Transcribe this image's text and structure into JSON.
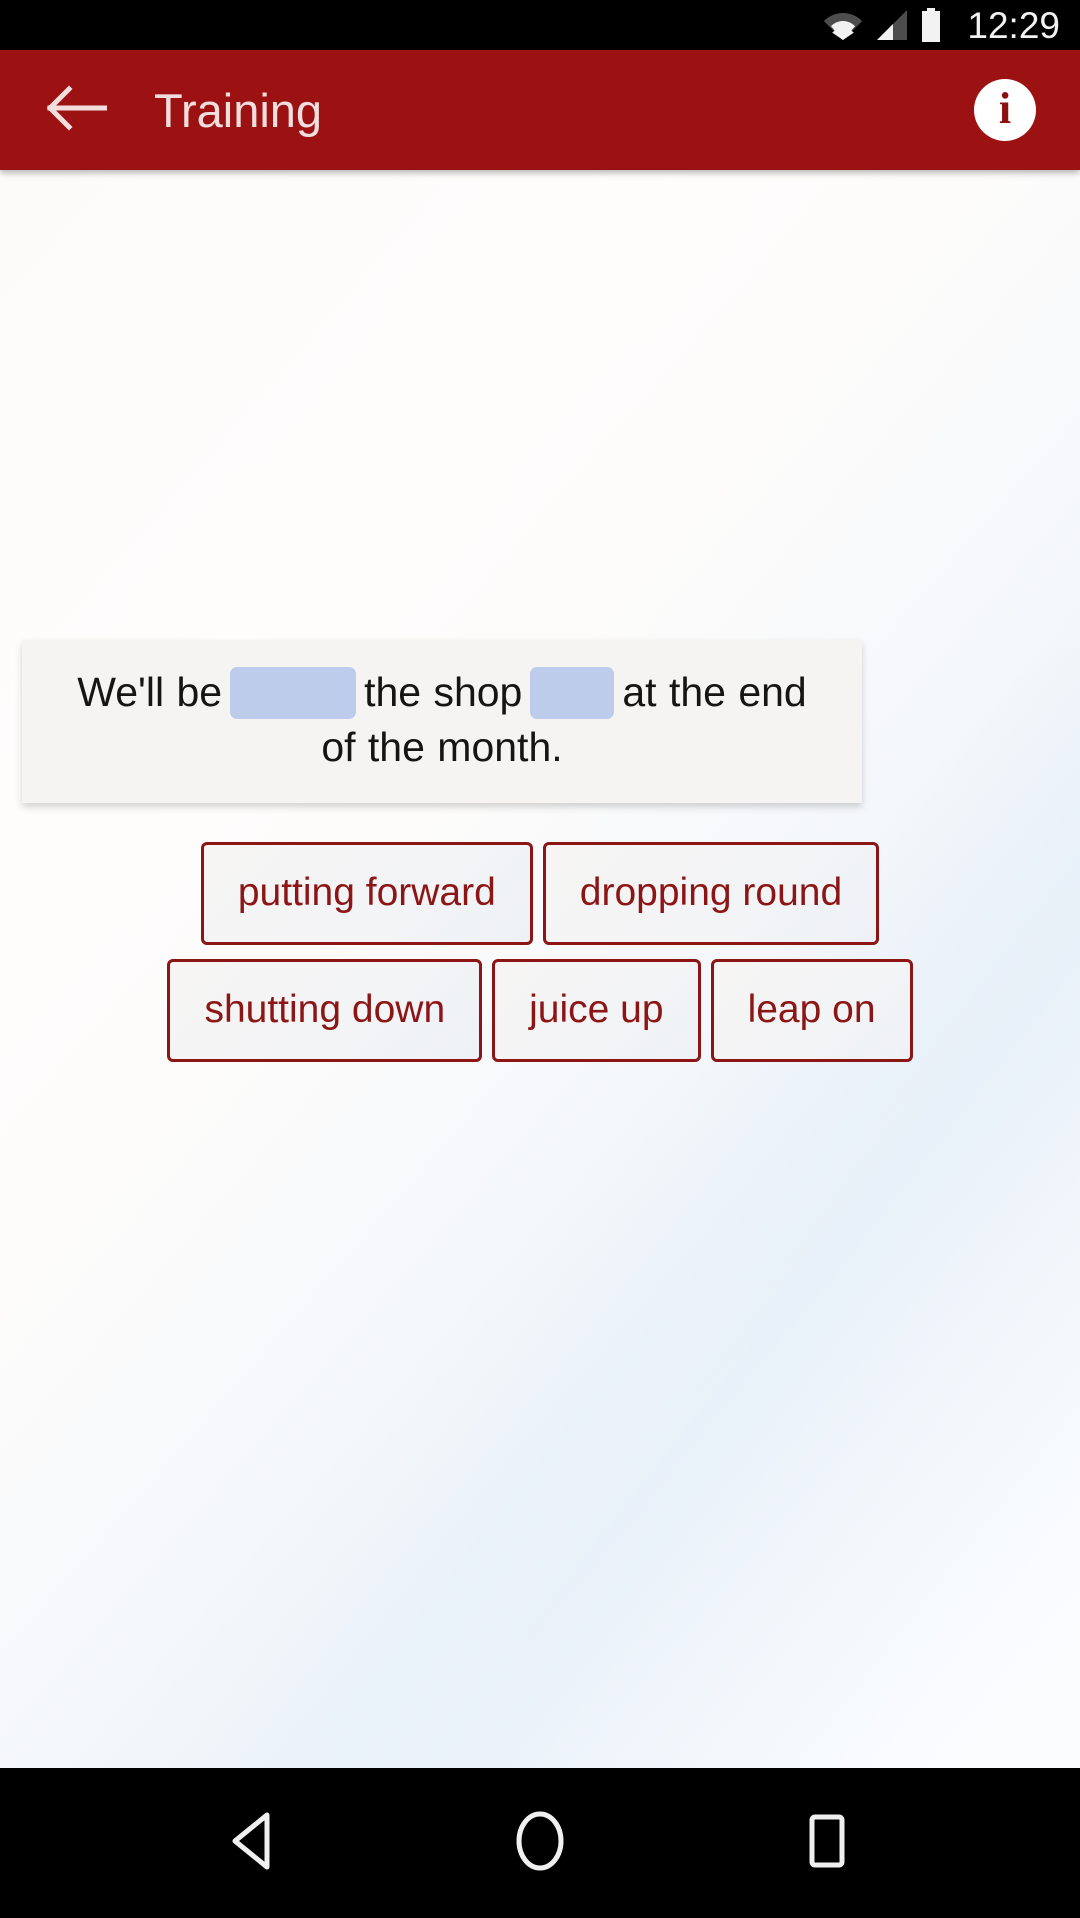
{
  "status_bar": {
    "time": "12:29",
    "icons": [
      "wifi-icon",
      "signal-icon",
      "battery-icon"
    ]
  },
  "app_bar": {
    "back_icon": "back-arrow-icon",
    "title": "Training",
    "info_icon": "info-icon",
    "info_glyph": "i",
    "background_color": "#9c1111",
    "title_color": "#f3dede"
  },
  "exercise": {
    "card_background": "#f5f4f2",
    "blank_color": "#bdccea",
    "sentence_parts": [
      {
        "type": "text",
        "value": "We'll be "
      },
      {
        "type": "blank",
        "value": ""
      },
      {
        "type": "text",
        "value": " the shop "
      },
      {
        "type": "blank",
        "value": ""
      },
      {
        "type": "text",
        "value": " at the end of the month."
      }
    ],
    "sentence_full": "We'll be ___ the shop ___ at the end of the month.",
    "text_before_blank1": "We'll be",
    "text_between_blanks": "the shop",
    "text_after_blank2": "at the end of the month."
  },
  "options": {
    "accent_color": "#8c1616",
    "rows": [
      [
        "putting forward",
        "dropping round"
      ],
      [
        "shutting down",
        "juice up",
        "leap on"
      ]
    ],
    "row1": {
      "option1": "putting forward",
      "option2": "dropping round"
    },
    "row2": {
      "option1": "shutting down",
      "option2": "juice up",
      "option3": "leap on"
    }
  },
  "nav_bar": {
    "back": "nav-back-icon",
    "home": "nav-home-icon",
    "recents": "nav-recents-icon"
  }
}
